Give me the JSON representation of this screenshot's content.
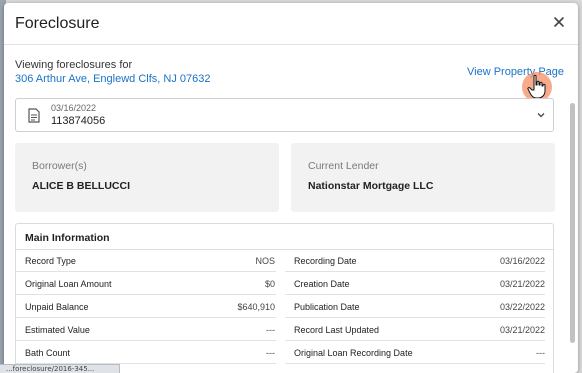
{
  "modal": {
    "title": "Foreclosure",
    "close_icon": "close-icon"
  },
  "location": {
    "viewing_label": "Viewing foreclosures for",
    "address": "306 Arthur Ave, Englewd Clfs, NJ 07632",
    "view_property_link": "View Property Page"
  },
  "record_select": {
    "date": "03/16/2022",
    "number": "113874056",
    "icon": "document-icon"
  },
  "borrower": {
    "label": "Borrower(s)",
    "value": "ALICE B BELLUCCI"
  },
  "lender": {
    "label": "Current Lender",
    "value": "Nationstar Mortgage LLC"
  },
  "main_info": {
    "title": "Main Information",
    "left_rows": [
      {
        "label": "Record Type",
        "value": "NOS"
      },
      {
        "label": "Original Loan Amount",
        "value": "$0"
      },
      {
        "label": "Unpaid Balance",
        "value": "$640,910"
      },
      {
        "label": "Estimated Value",
        "value": "---"
      },
      {
        "label": "Bath Count",
        "value": "---"
      }
    ],
    "right_rows": [
      {
        "label": "Recording Date",
        "value": "03/16/2022"
      },
      {
        "label": "Creation Date",
        "value": "03/21/2022"
      },
      {
        "label": "Publication Date",
        "value": "03/22/2022"
      },
      {
        "label": "Record Last Updated",
        "value": "03/21/2022"
      },
      {
        "label": "Original Loan Recording Date",
        "value": "---"
      }
    ]
  },
  "status_bar": {
    "text": "...foreclosure/2016-345..."
  },
  "colors": {
    "link": "#1a73c8",
    "card_bg": "#f2f2f2",
    "cursor_halo": "#f48f64"
  }
}
